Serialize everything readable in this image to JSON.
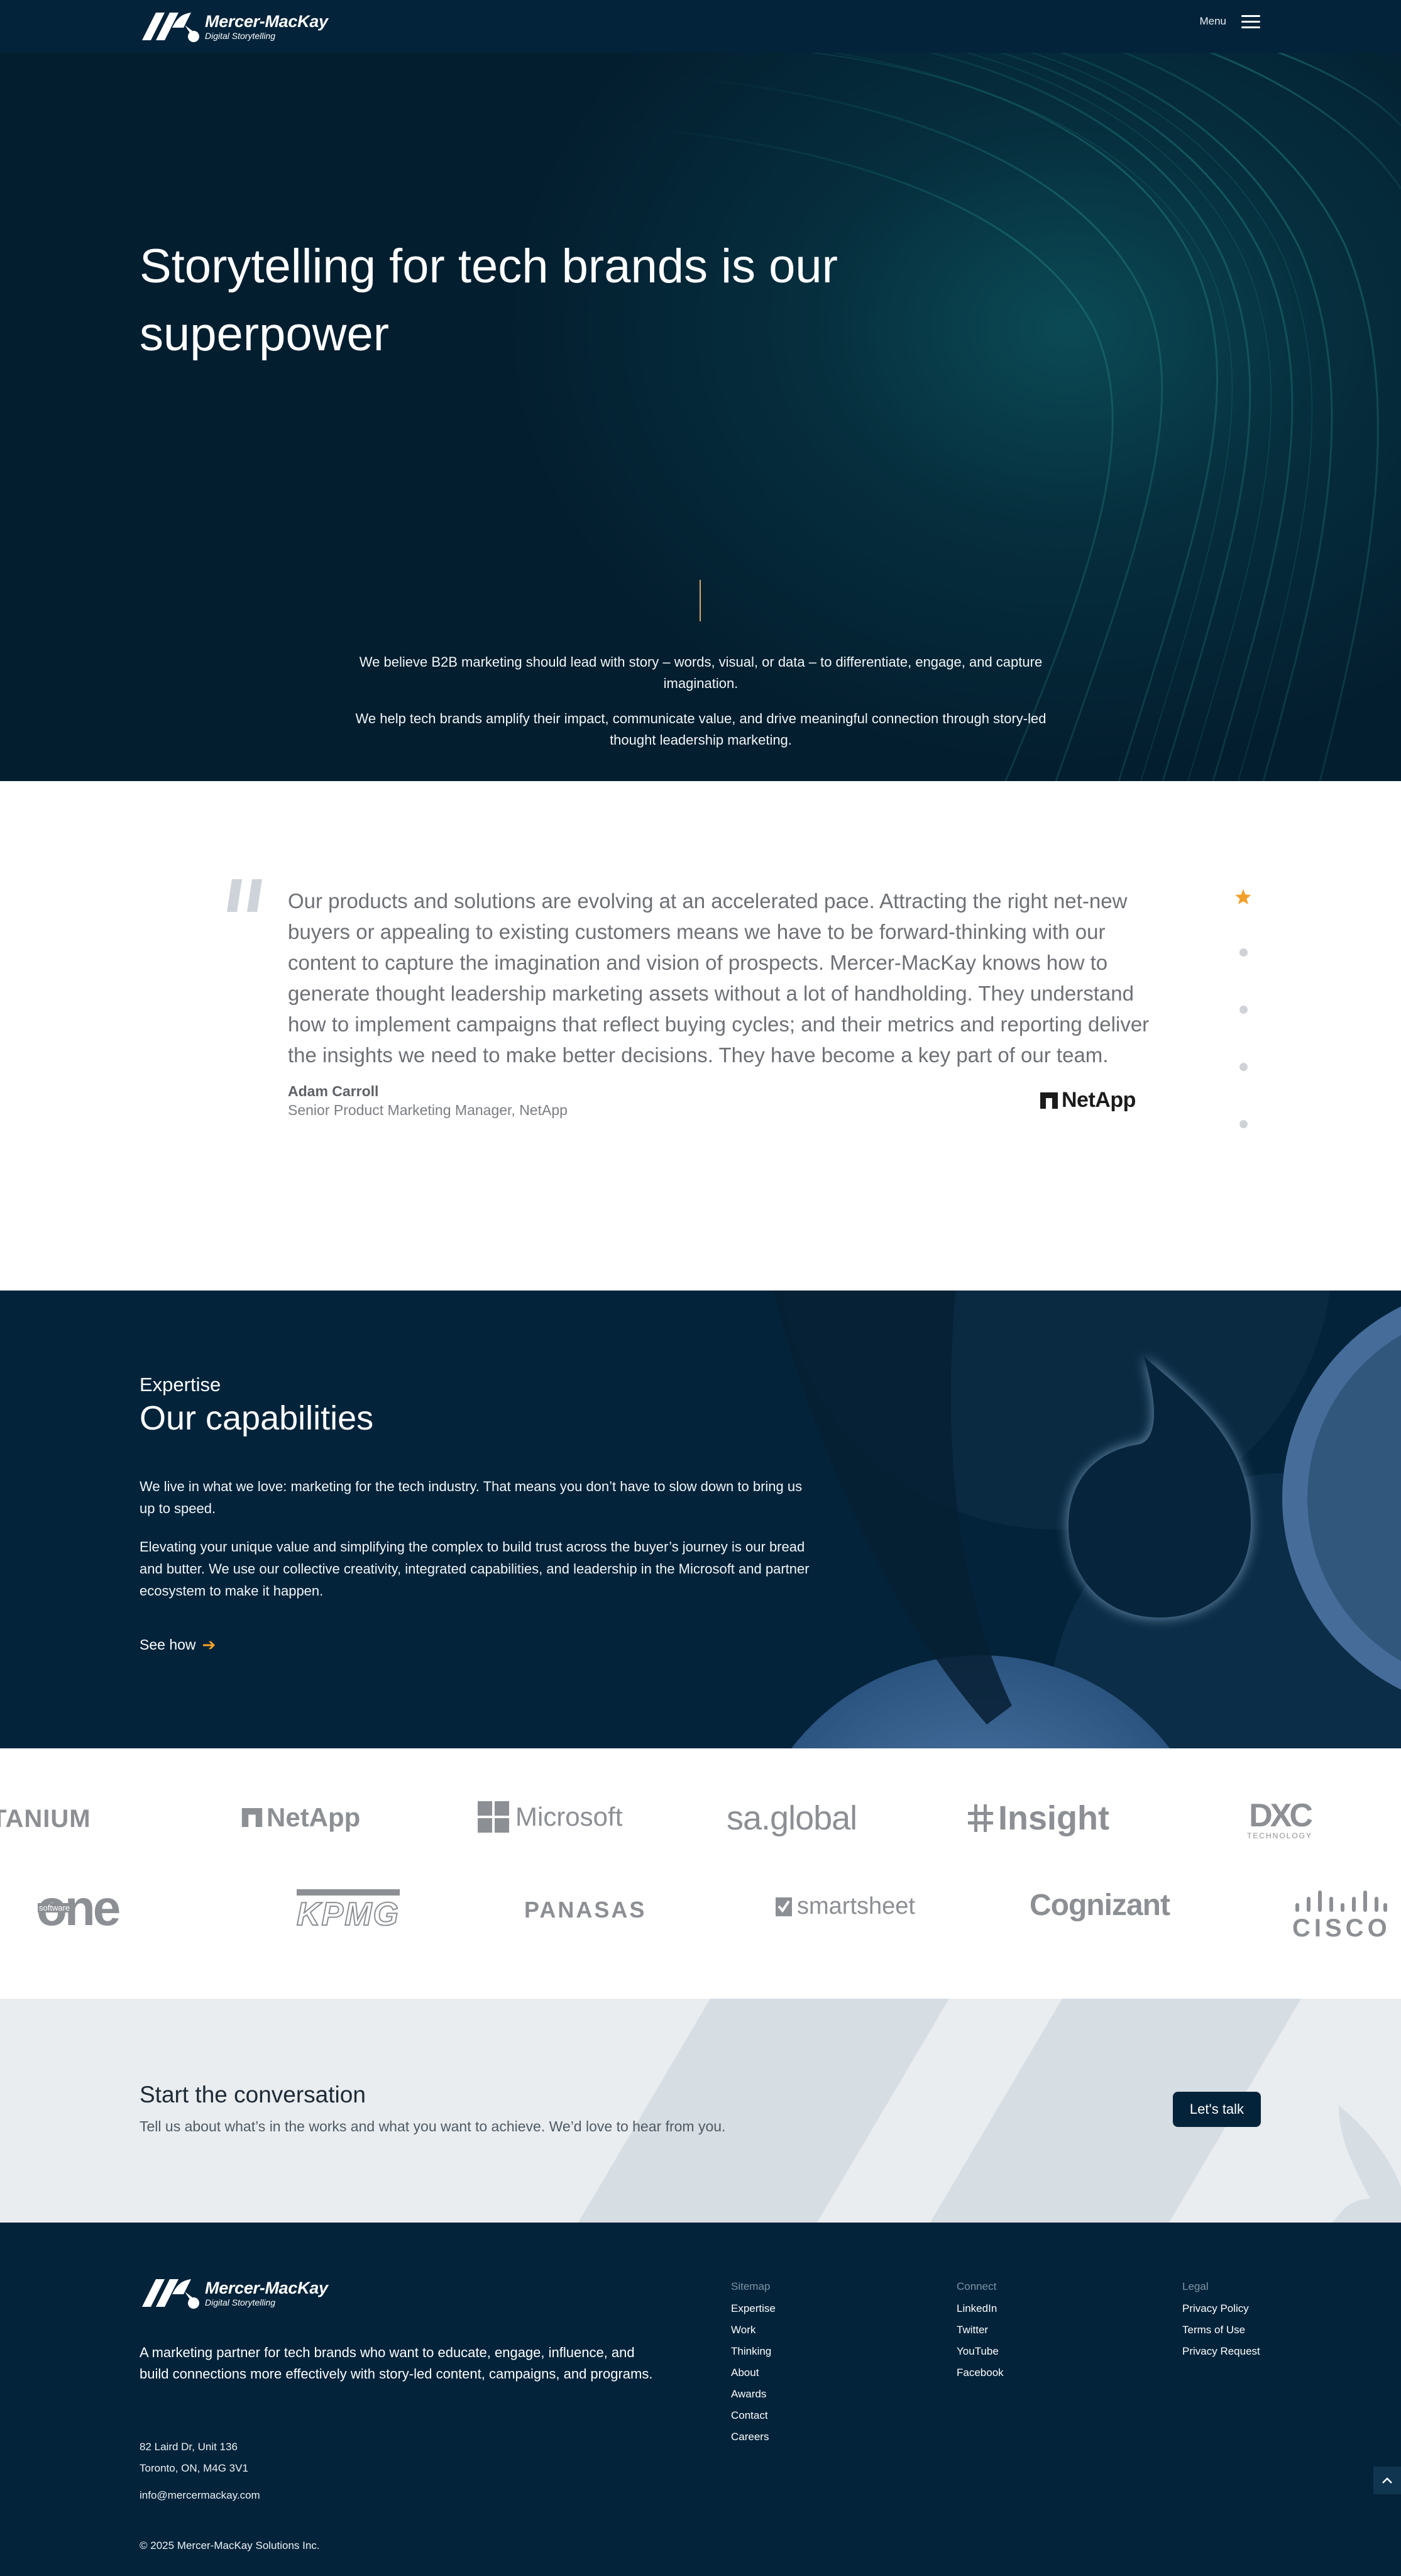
{
  "header": {
    "brand_name": "Mercer-MacKay",
    "brand_tagline": "Digital Storytelling",
    "menu_label": "Menu"
  },
  "hero": {
    "title": "Storytelling for tech brands is our superpower",
    "paragraph_1": "We believe B2B marketing should lead with story – words, visual, or data – to differentiate, engage, and capture imagination.",
    "paragraph_2": "We help tech brands amplify their impact, communicate value, and drive meaningful connection through story-led thought leadership marketing."
  },
  "testimonial": {
    "quote": "Our products and solutions are evolving at an accelerated pace. Attracting the right net-new buyers or appealing to existing customers means we have to be forward-thinking with our content to capture the imagination and vision of prospects. Mercer-MacKay knows how to generate thought leadership marketing assets without a lot of handholding. They understand how to implement campaigns that reflect buying cycles; and their metrics and reporting deliver the insights we need to make better decisions. They have become a key part of our team.",
    "author": "Adam Carroll",
    "role": "Senior Product Marketing Manager, NetApp",
    "company_logo": "NetApp",
    "pager": {
      "total": 5,
      "active": 1
    }
  },
  "capabilities": {
    "eyebrow": "Expertise",
    "title": "Our capabilities",
    "paragraph_1": "We live in what we love: marketing for the tech industry. That means you don’t have to slow down to bring us up to speed.",
    "paragraph_2": "Elevating your unique value and simplifying the complex to build trust across the buyer’s journey is our bread and butter. We use our collective creativity, integrated capabilities, and leadership in the Microsoft and partner ecosystem to make it happen.",
    "link_label": "See how"
  },
  "clients": {
    "row_1": [
      "TANIUM",
      "NetApp",
      "Microsoft",
      "sa.global",
      "Insight",
      "DXC"
    ],
    "row_1_sub": {
      "dxc": "TECHNOLOGY"
    },
    "row_2": [
      "one",
      "KPMG",
      "PANASAS",
      "smartsheet",
      "Cognizant",
      "CISCO"
    ],
    "row_2_sub": {
      "one": "software"
    }
  },
  "cta": {
    "title": "Start the conversation",
    "subtitle": "Tell us about what’s in the works and what you want to achieve. We’d love to hear from you.",
    "button_label": "Let's talk"
  },
  "footer": {
    "brand_name": "Mercer-MacKay",
    "brand_tagline": "Digital Storytelling",
    "tagline": "A marketing partner for tech brands who want to educate, engage, influence, and build connections more effectively with story-led content, campaigns, and programs.",
    "address_line_1": "82 Laird Dr, Unit 136",
    "address_line_2": "Toronto, ON, M4G 3V1",
    "email": "info@mercermackay.com",
    "copyright": "© 2025 Mercer-MacKay Solutions Inc.",
    "columns": [
      {
        "title": "Sitemap",
        "links": [
          "Expertise",
          "Work",
          "Thinking",
          "About",
          "Awards",
          "Contact",
          "Careers"
        ]
      },
      {
        "title": "Connect",
        "links": [
          "LinkedIn",
          "Twitter",
          "YouTube",
          "Facebook"
        ]
      },
      {
        "title": "Legal",
        "links": [
          "Privacy Policy",
          "Terms of Use",
          "Privacy Request"
        ]
      }
    ]
  },
  "colors": {
    "navy": "#03233a",
    "accent_orange": "#f3a02a",
    "cta_background": "#e9edf0",
    "logo_gray": "#8c8f93"
  },
  "icons": [
    "menu-icon",
    "quote-icon",
    "star-icon",
    "arrow-right-icon",
    "chevron-up-icon"
  ]
}
